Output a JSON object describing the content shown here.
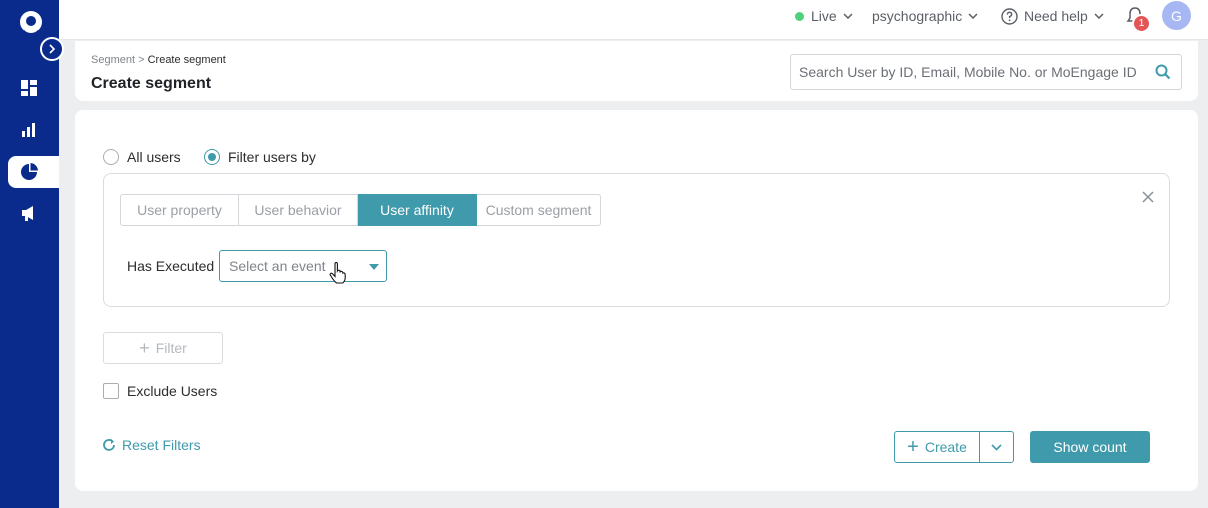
{
  "topbar": {
    "env_label": "Live",
    "workspace_label": "psychographic",
    "help_label": "Need help",
    "notification_count": "1",
    "avatar_initial": "G"
  },
  "header": {
    "breadcrumb_parent": "Segment",
    "breadcrumb_sep": ">",
    "breadcrumb_current": "Create segment",
    "title": "Create segment",
    "search_placeholder": "Search User by ID, Email, Mobile No. or MoEngage ID"
  },
  "audience": {
    "options": [
      {
        "label": "All users",
        "selected": false
      },
      {
        "label": "Filter users by",
        "selected": true
      }
    ]
  },
  "filter": {
    "tabs": [
      {
        "label": "User property",
        "active": false
      },
      {
        "label": "User behavior",
        "active": false
      },
      {
        "label": "User affinity",
        "active": true
      },
      {
        "label": "Custom segment",
        "active": false
      }
    ],
    "condition_label": "Has Executed",
    "event_placeholder": "Select an event"
  },
  "actions": {
    "add_filter_label": "Filter",
    "exclude_label": "Exclude Users",
    "reset_label": "Reset Filters",
    "create_label": "Create",
    "show_count_label": "Show count"
  },
  "colors": {
    "sidebar": "#0a2b8c",
    "accent": "#3f9aab",
    "live": "#4fd17c",
    "badge": "#e45557",
    "avatar": "#a7b7f4"
  }
}
